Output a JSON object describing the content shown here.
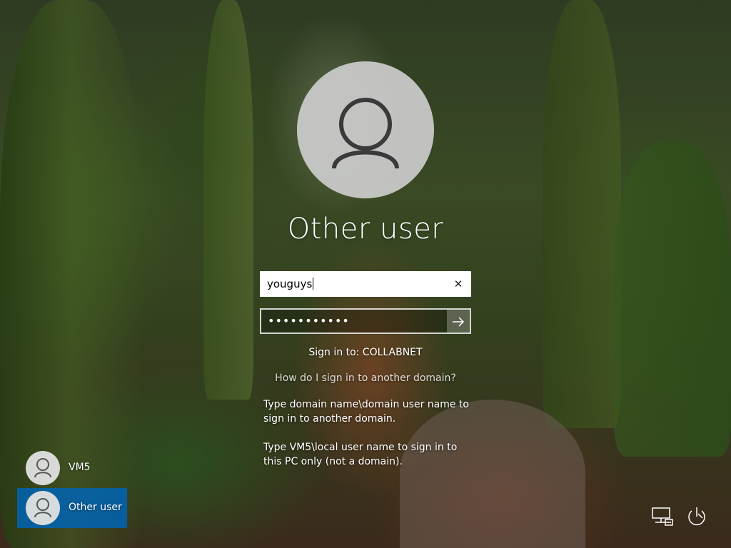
{
  "selected_user": {
    "name": "Other user",
    "avatar_icon": "person-icon"
  },
  "username_field": {
    "value": "youguys",
    "clear_icon": "close-icon"
  },
  "password_field": {
    "masked_value": "•••••••••••",
    "submit_icon": "arrow-right-icon"
  },
  "signin_domain": "Sign in to: COLLABNET",
  "help_link": "How do I sign in to another domain?",
  "hints": [
    "Type domain name\\domain user name to sign in to another domain.",
    "Type VM5\\local user name to sign in to this PC only (not a domain)."
  ],
  "user_list": [
    {
      "label": "VM5",
      "selected": false
    },
    {
      "label": "Other user",
      "selected": true
    }
  ],
  "corner_icons": [
    "network-icon",
    "power-icon"
  ],
  "colors": {
    "selected_tile": "#0064b4"
  }
}
